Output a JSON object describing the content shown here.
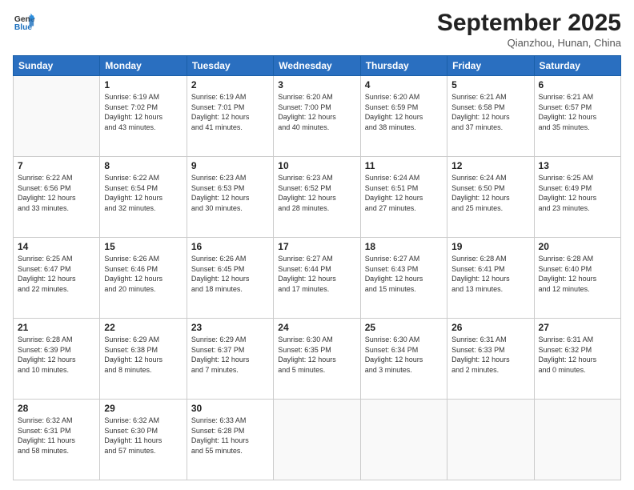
{
  "header": {
    "logo_general": "General",
    "logo_blue": "Blue",
    "month_title": "September 2025",
    "location": "Qianzhou, Hunan, China"
  },
  "weekdays": [
    "Sunday",
    "Monday",
    "Tuesday",
    "Wednesday",
    "Thursday",
    "Friday",
    "Saturday"
  ],
  "weeks": [
    [
      {
        "day": "",
        "text": ""
      },
      {
        "day": "1",
        "text": "Sunrise: 6:19 AM\nSunset: 7:02 PM\nDaylight: 12 hours\nand 43 minutes."
      },
      {
        "day": "2",
        "text": "Sunrise: 6:19 AM\nSunset: 7:01 PM\nDaylight: 12 hours\nand 41 minutes."
      },
      {
        "day": "3",
        "text": "Sunrise: 6:20 AM\nSunset: 7:00 PM\nDaylight: 12 hours\nand 40 minutes."
      },
      {
        "day": "4",
        "text": "Sunrise: 6:20 AM\nSunset: 6:59 PM\nDaylight: 12 hours\nand 38 minutes."
      },
      {
        "day": "5",
        "text": "Sunrise: 6:21 AM\nSunset: 6:58 PM\nDaylight: 12 hours\nand 37 minutes."
      },
      {
        "day": "6",
        "text": "Sunrise: 6:21 AM\nSunset: 6:57 PM\nDaylight: 12 hours\nand 35 minutes."
      }
    ],
    [
      {
        "day": "7",
        "text": "Sunrise: 6:22 AM\nSunset: 6:56 PM\nDaylight: 12 hours\nand 33 minutes."
      },
      {
        "day": "8",
        "text": "Sunrise: 6:22 AM\nSunset: 6:54 PM\nDaylight: 12 hours\nand 32 minutes."
      },
      {
        "day": "9",
        "text": "Sunrise: 6:23 AM\nSunset: 6:53 PM\nDaylight: 12 hours\nand 30 minutes."
      },
      {
        "day": "10",
        "text": "Sunrise: 6:23 AM\nSunset: 6:52 PM\nDaylight: 12 hours\nand 28 minutes."
      },
      {
        "day": "11",
        "text": "Sunrise: 6:24 AM\nSunset: 6:51 PM\nDaylight: 12 hours\nand 27 minutes."
      },
      {
        "day": "12",
        "text": "Sunrise: 6:24 AM\nSunset: 6:50 PM\nDaylight: 12 hours\nand 25 minutes."
      },
      {
        "day": "13",
        "text": "Sunrise: 6:25 AM\nSunset: 6:49 PM\nDaylight: 12 hours\nand 23 minutes."
      }
    ],
    [
      {
        "day": "14",
        "text": "Sunrise: 6:25 AM\nSunset: 6:47 PM\nDaylight: 12 hours\nand 22 minutes."
      },
      {
        "day": "15",
        "text": "Sunrise: 6:26 AM\nSunset: 6:46 PM\nDaylight: 12 hours\nand 20 minutes."
      },
      {
        "day": "16",
        "text": "Sunrise: 6:26 AM\nSunset: 6:45 PM\nDaylight: 12 hours\nand 18 minutes."
      },
      {
        "day": "17",
        "text": "Sunrise: 6:27 AM\nSunset: 6:44 PM\nDaylight: 12 hours\nand 17 minutes."
      },
      {
        "day": "18",
        "text": "Sunrise: 6:27 AM\nSunset: 6:43 PM\nDaylight: 12 hours\nand 15 minutes."
      },
      {
        "day": "19",
        "text": "Sunrise: 6:28 AM\nSunset: 6:41 PM\nDaylight: 12 hours\nand 13 minutes."
      },
      {
        "day": "20",
        "text": "Sunrise: 6:28 AM\nSunset: 6:40 PM\nDaylight: 12 hours\nand 12 minutes."
      }
    ],
    [
      {
        "day": "21",
        "text": "Sunrise: 6:28 AM\nSunset: 6:39 PM\nDaylight: 12 hours\nand 10 minutes."
      },
      {
        "day": "22",
        "text": "Sunrise: 6:29 AM\nSunset: 6:38 PM\nDaylight: 12 hours\nand 8 minutes."
      },
      {
        "day": "23",
        "text": "Sunrise: 6:29 AM\nSunset: 6:37 PM\nDaylight: 12 hours\nand 7 minutes."
      },
      {
        "day": "24",
        "text": "Sunrise: 6:30 AM\nSunset: 6:35 PM\nDaylight: 12 hours\nand 5 minutes."
      },
      {
        "day": "25",
        "text": "Sunrise: 6:30 AM\nSunset: 6:34 PM\nDaylight: 12 hours\nand 3 minutes."
      },
      {
        "day": "26",
        "text": "Sunrise: 6:31 AM\nSunset: 6:33 PM\nDaylight: 12 hours\nand 2 minutes."
      },
      {
        "day": "27",
        "text": "Sunrise: 6:31 AM\nSunset: 6:32 PM\nDaylight: 12 hours\nand 0 minutes."
      }
    ],
    [
      {
        "day": "28",
        "text": "Sunrise: 6:32 AM\nSunset: 6:31 PM\nDaylight: 11 hours\nand 58 minutes."
      },
      {
        "day": "29",
        "text": "Sunrise: 6:32 AM\nSunset: 6:30 PM\nDaylight: 11 hours\nand 57 minutes."
      },
      {
        "day": "30",
        "text": "Sunrise: 6:33 AM\nSunset: 6:28 PM\nDaylight: 11 hours\nand 55 minutes."
      },
      {
        "day": "",
        "text": ""
      },
      {
        "day": "",
        "text": ""
      },
      {
        "day": "",
        "text": ""
      },
      {
        "day": "",
        "text": ""
      }
    ]
  ]
}
